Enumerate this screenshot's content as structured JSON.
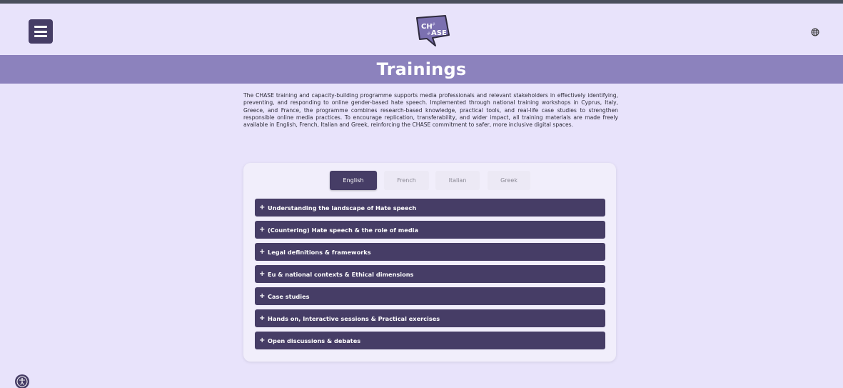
{
  "header": {
    "logo_alt": "CHASE",
    "menu_icon": "hamburger-menu-icon",
    "language_icon": "globe-icon"
  },
  "page": {
    "title": "Trainings",
    "intro": "The CHASE training and capacity-building programme supports media professionals and relevant stakeholders in effectively identifying, preventing, and responding to online gender-based hate speech. Implemented through national training workshops in Cyprus, Italy, Greece, and France, the programme combines research-based knowledge, practical tools, and real-life case studies to strengthen responsible online media practices. To encourage replication, transferability, and wider impact, all training materials are made freely available in English, French, Italian and Greek, reinforcing the CHASE commitment to safer, more inclusive digital spaces."
  },
  "tabs": [
    {
      "label": "English",
      "active": true
    },
    {
      "label": "French",
      "active": false
    },
    {
      "label": "Italian",
      "active": false
    },
    {
      "label": "Greek",
      "active": false
    }
  ],
  "accordion": [
    {
      "icon": "+",
      "label": "Understanding the landscape of Hate speech"
    },
    {
      "icon": "+",
      "label": "(Countering) Hate speech & the role of media"
    },
    {
      "icon": "+",
      "label": "Legal definitions & frameworks"
    },
    {
      "icon": "+",
      "label": "Eu & national contexts & Ethical dimensions"
    },
    {
      "icon": "+",
      "label": "Case studies"
    },
    {
      "icon": "+",
      "label": "Hands on, Interactive sessions & Practical exercises"
    },
    {
      "icon": "+",
      "label": "Open discussions & debates"
    }
  ],
  "colors": {
    "background": "#e8e3fb",
    "accent": "#463d66",
    "title_band": "#8c82bd"
  }
}
